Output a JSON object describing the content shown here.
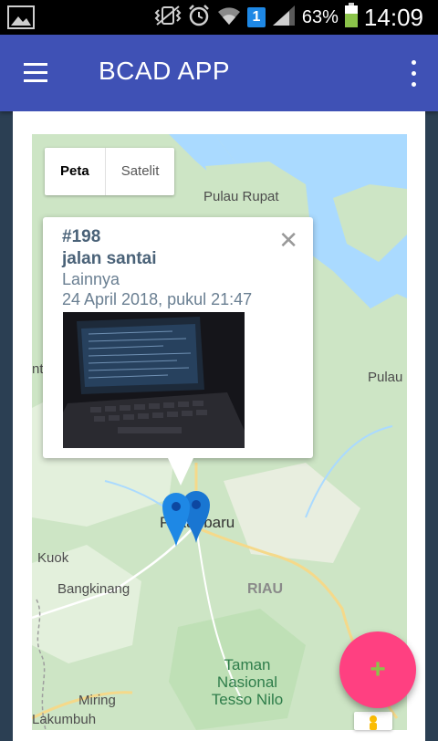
{
  "status_bar": {
    "signal_percent": "63%",
    "time": "14:09",
    "notification_count": "1",
    "icons": [
      "image-icon",
      "vibrate-icon",
      "alarm-icon",
      "wifi-icon",
      "signal-icon",
      "battery-icon"
    ]
  },
  "app_bar": {
    "title": "BCAD APP",
    "menu_icon": "hamburger-menu-icon",
    "overflow_icon": "more-vert-icon",
    "color": "#3f51b5"
  },
  "map": {
    "map_type_options": [
      {
        "label": "Peta",
        "selected": true
      },
      {
        "label": "Satelit",
        "selected": false
      }
    ],
    "labels": {
      "pulau_rupat": "Pulau Rupat",
      "pulau": "Pulau",
      "pekanbaru": "Pekanbaru",
      "kuok": "Kuok",
      "bangkinang": "Bangkinang",
      "riau": "RIAU",
      "taman_nasional": "Taman Nasional Tesso Nilo",
      "miring": "Miring",
      "lakumbuh": "Lakumbuh",
      "left_edge": "nt"
    },
    "marker_icon": "map-pin-icon",
    "marker_color": "#1e88e5"
  },
  "info_window": {
    "id": "#198",
    "title": "jalan santai",
    "category": "Lainnya",
    "date": "24 April 2018, pukul 21:47",
    "close_icon": "close-icon",
    "photo_description_icon": "laptop-photo"
  },
  "fab": {
    "label": "+",
    "icon": "plus-icon",
    "color": "#ff4081"
  },
  "pegman_icon": "street-view-pegman-icon"
}
